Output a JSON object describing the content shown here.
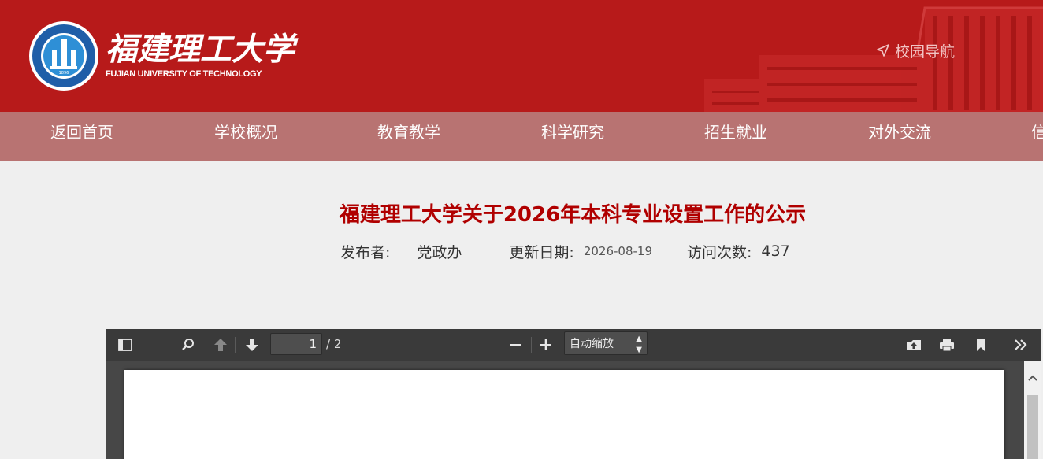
{
  "header": {
    "brand_cn": "福建理工大学",
    "brand_en": "FUJIAN UNIVERSITY OF TECHNOLOGY",
    "campus_nav_label": "校园导航",
    "brand_color": "#b71a1a"
  },
  "nav": {
    "items": [
      {
        "label": "返回首页"
      },
      {
        "label": "学校概况"
      },
      {
        "label": "教育教学"
      },
      {
        "label": "科学研究"
      },
      {
        "label": "招生就业"
      },
      {
        "label": "对外交流"
      },
      {
        "label": "信"
      }
    ],
    "bar_color": "#b87372"
  },
  "article": {
    "title": "福建理工大学关于2026年本科专业设置工作的公示",
    "publisher_label": "发布者:",
    "publisher": "党政办",
    "date_label": "更新日期:",
    "date": "2026-08-19",
    "views_label": "访问次数:",
    "views": "437",
    "title_color": "#b00000"
  },
  "pdf_viewer": {
    "page_number": "1",
    "page_total": "/ 2",
    "zoom_label": "自动缩放",
    "icons": [
      "sidebar-toggle-icon",
      "search-icon",
      "arrow-up-icon",
      "arrow-down-icon",
      "zoom-out-icon",
      "zoom-in-icon",
      "open-file-icon",
      "print-icon",
      "bookmark-icon",
      "tools-icon"
    ]
  }
}
